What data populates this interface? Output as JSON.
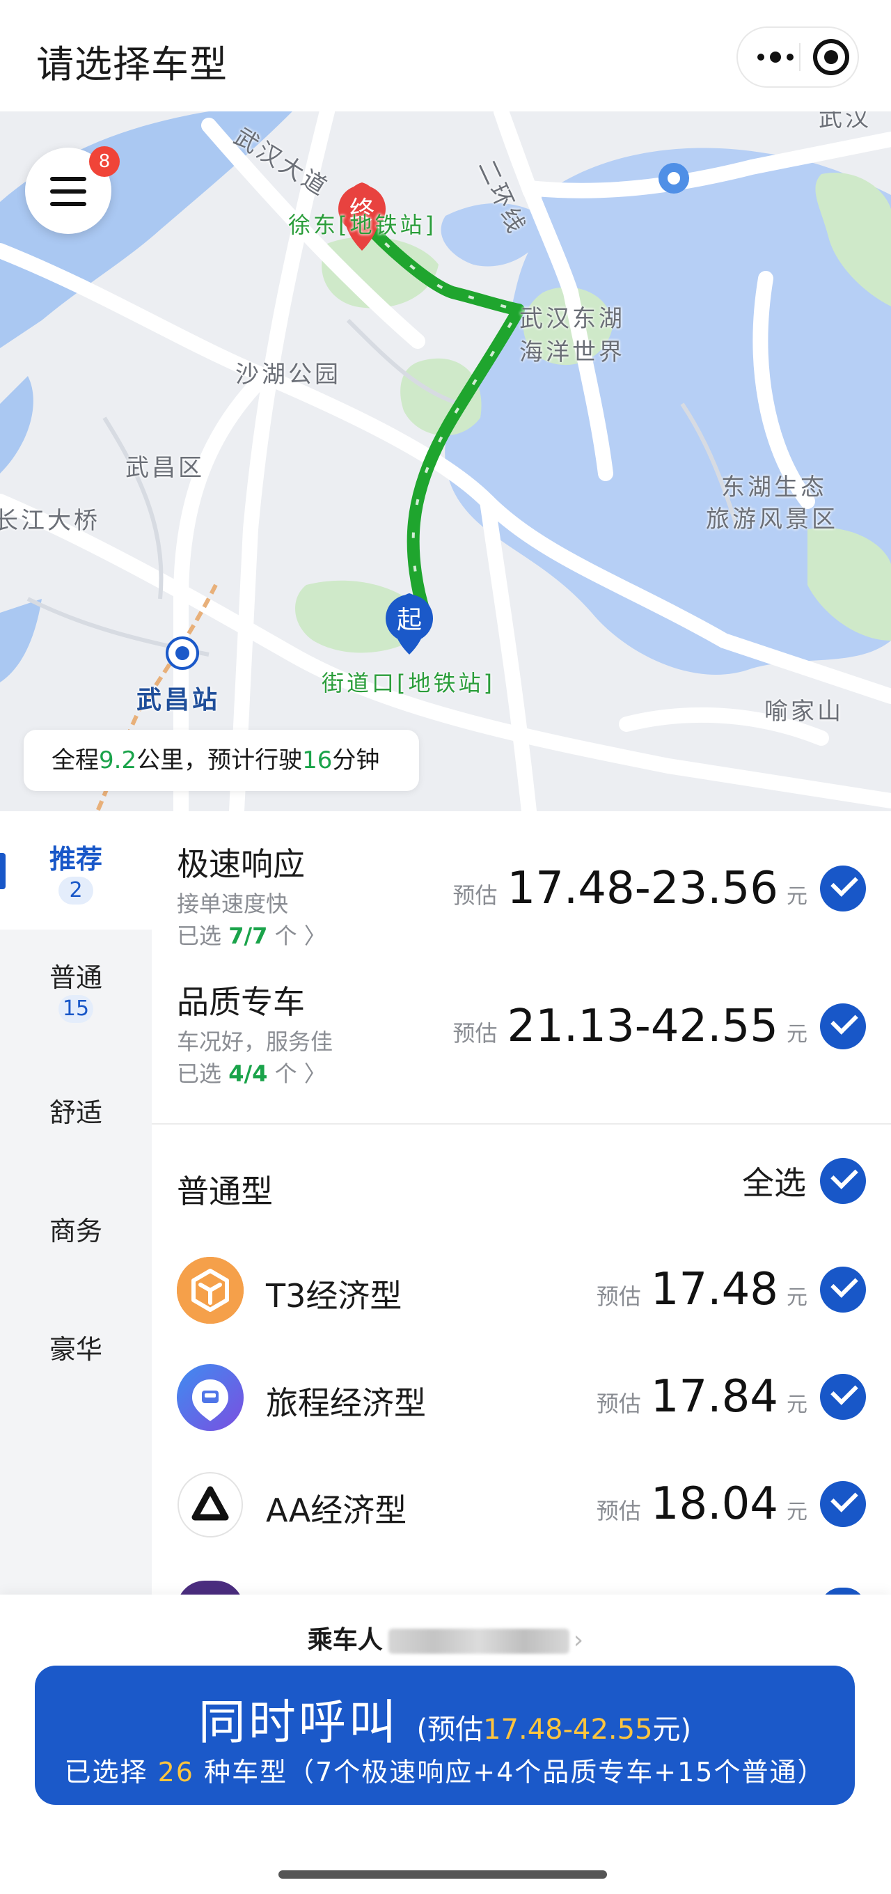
{
  "header": {
    "title": "请选择车型"
  },
  "map": {
    "menu_badge": "8",
    "end_marker": "终",
    "start_marker": "起",
    "labels": {
      "wuhan_avenue": "武汉大道",
      "xudong": "徐东[地铁站]",
      "second_ring": "二环线",
      "donghu_ocean": "武汉东湖",
      "donghu_ocean2": "海洋世界",
      "shahu_park": "沙湖公园",
      "wuchang_district": "武昌区",
      "changjiang_bridge": "长江大桥",
      "donghu_scenic": "东湖生态",
      "donghu_scenic2": "旅游风景区",
      "jiedaokou": "街道口[地铁站]",
      "wuchang_station": "武昌站",
      "yujiashan": "喻家山",
      "top_right": "武汉"
    },
    "route_info": {
      "prefix": "全程",
      "distance": "9.2",
      "middle": "公里，预计行驶",
      "minutes": "16",
      "suffix": "分钟"
    }
  },
  "sidebar": {
    "items": [
      {
        "label": "推荐",
        "count": "2"
      },
      {
        "label": "普通",
        "count": "15"
      },
      {
        "label": "舒适"
      },
      {
        "label": "商务"
      },
      {
        "label": "豪华"
      }
    ]
  },
  "recommended": [
    {
      "name": "极速响应",
      "desc": "接单速度快",
      "selected_prefix": "已选",
      "selected_count": "7/7",
      "selected_suffix": "个 〉",
      "price_prefix": "预估",
      "price": "17.48-23.56",
      "unit": "元"
    },
    {
      "name": "品质专车",
      "desc": "车况好，服务佳",
      "selected_prefix": "已选",
      "selected_count": "4/4",
      "selected_suffix": "个 〉",
      "price_prefix": "预估",
      "price": "21.13-42.55",
      "unit": "元"
    }
  ],
  "group": {
    "title": "普通型",
    "select_all": "全选",
    "cars": [
      {
        "name": "T3经济型",
        "price_prefix": "预估",
        "price": "17.48",
        "unit": "元",
        "logo": "t3-logo"
      },
      {
        "name": "旅程经济型",
        "price_prefix": "预估",
        "price": "17.84",
        "unit": "元",
        "logo": "lvcheng-logo"
      },
      {
        "name": "AA经济型",
        "price_prefix": "预估",
        "price": "18.04",
        "unit": "元",
        "logo": "aa-logo"
      }
    ]
  },
  "footer": {
    "passenger_label": "乘车人",
    "call_label": "同时呼叫",
    "est_open": "(预估",
    "est_range": "17.48-42.55",
    "est_close": "元)",
    "sub_prefix": "已选择",
    "sub_count": "26",
    "sub_suffix": "种车型（7个极速响应+4个品质专车+15个普通）"
  },
  "colors": {
    "accent_blue": "#1b59c9",
    "route_green": "#1fa52e",
    "price_yellow": "#ffc53d",
    "badge_red": "#f04438"
  }
}
